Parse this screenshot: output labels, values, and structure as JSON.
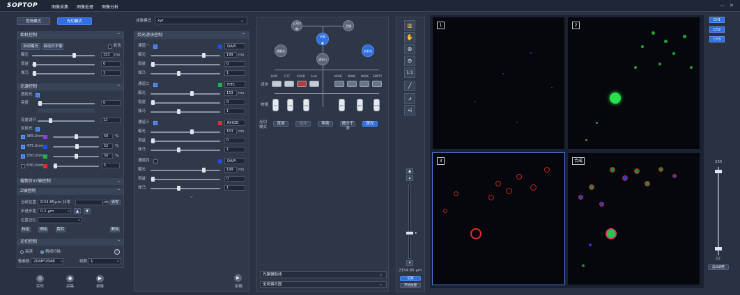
{
  "app": {
    "logo": "SOPTOP",
    "menu": [
      "图像采集",
      "图像处理",
      "图像分析"
    ],
    "window_controls": [
      "—",
      "✕"
    ]
  },
  "mode_tabs": [
    "宽场模式",
    "光切模式"
  ],
  "camera": {
    "title": "相机控制",
    "buttons": [
      "自动曝光",
      "自动白平衡"
    ],
    "color_label": "彩色",
    "rows": [
      {
        "label": "曝光",
        "value": "153",
        "unit": "ms"
      },
      {
        "label": "增益",
        "value": "0"
      },
      {
        "label": "伽马",
        "value": "1"
      }
    ]
  },
  "light": {
    "title": "光源控制",
    "transmit_label": "透射光",
    "brightness_label": "亮度",
    "brightness_value": "0",
    "flash_label": "亮度调节",
    "flash_value": "12",
    "fluor_label": "反射光",
    "channels": [
      {
        "label": "385.0nm",
        "value": "50",
        "unit": "%",
        "color": "#8a3cf0",
        "on": true
      },
      {
        "label": "475.0nm",
        "value": "52",
        "unit": "%",
        "color": "#1f4fe0",
        "on": true
      },
      {
        "label": "550.0nm",
        "value": "50",
        "unit": "%",
        "color": "#22b04a",
        "on": true
      },
      {
        "label": "630.0nm",
        "value": "5",
        "unit": "",
        "color": "#d83030",
        "on": false
      }
    ]
  },
  "xy": {
    "title": "载物台XY轴控制"
  },
  "z": {
    "title": "Z轴控制",
    "pos_label": "当前位置",
    "pos_value": "2154.85",
    "pos_unit": "μm",
    "pos_unit2": "μm",
    "reset_label": "归零",
    "reset_btn": "清零",
    "step_label": "步进步距",
    "step_value": "0.1 μm",
    "mem_label": "位置记忆",
    "buttons": [
      "标定",
      "清除",
      "跳转",
      "删除"
    ]
  },
  "optic": {
    "title": "光切控制",
    "radio": [
      "高速",
      "精细扫描"
    ],
    "res_label": "像素数",
    "res_value": "2048*2048",
    "bin_label": "帧数",
    "bin_value": "1",
    "actions": [
      "实时",
      "采集",
      "录像"
    ]
  },
  "middle": {
    "mode_label": "成像模式",
    "mode_value": "xyt",
    "filter_title": "荧光滤块控制",
    "channels": [
      {
        "name": "通道一",
        "dye": "DAPI",
        "color": "#1f4fe0",
        "exp": "199",
        "gain": "0",
        "gamma": "1",
        "on": true
      },
      {
        "name": "通道二",
        "dye": "FITC",
        "color": "#22b04a",
        "exp": "153",
        "gain": "0",
        "gamma": "1",
        "on": true
      },
      {
        "name": "通道三",
        "dye": "RHOD",
        "color": "#d83030",
        "exp": "153",
        "gain": "0",
        "gamma": "1",
        "on": true
      },
      {
        "name": "通道四",
        "dye": "DAPI",
        "color": "#1f4fe0",
        "exp": "199",
        "gain": "0",
        "gamma": "1",
        "on": false
      }
    ],
    "row_labels": [
      "曝光",
      "增益",
      "伽马"
    ],
    "exp_unit": "ms",
    "play_label": "拍摄"
  },
  "diagram": {
    "top_nodes": [
      "上光口",
      "目镜"
    ],
    "mid_node": "光路",
    "left_node": "透射光",
    "right_node": "反射光",
    "center_node": "滤光口",
    "cube_row_label": "滤块",
    "cubes": [
      "DAPI",
      "FITC",
      "RHOD",
      "Anal",
      "NONE",
      "NONE",
      "NONE",
      "EMPTY"
    ],
    "tube_row_label": "物镜",
    "tubes": [
      "4X",
      "10X",
      "20X",
      "",
      "40X",
      "60X",
      "100X"
    ],
    "mode_label": "光切模式",
    "mode_buttons": [
      "宽场",
      "暗场",
      "明场",
      "微分干涉",
      "荧光"
    ],
    "dropdowns": [
      "光路辅助线",
      "全局偏方图"
    ]
  },
  "ztrack": {
    "value": "2154.85 μm",
    "btn1": "记录",
    "btn2": "开始拍摄"
  },
  "tools": [
    "▥",
    "✋",
    "⊕",
    "⊖",
    "1:1",
    "╱",
    "⩘",
    "⩤"
  ],
  "viewer": {
    "labels": [
      "1",
      "2",
      "3",
      "合成"
    ],
    "channel_buttons": [
      "CH1",
      "CH2",
      "CH3"
    ]
  },
  "slider": {
    "max": "255",
    "min": "22",
    "button": "自动调整"
  }
}
